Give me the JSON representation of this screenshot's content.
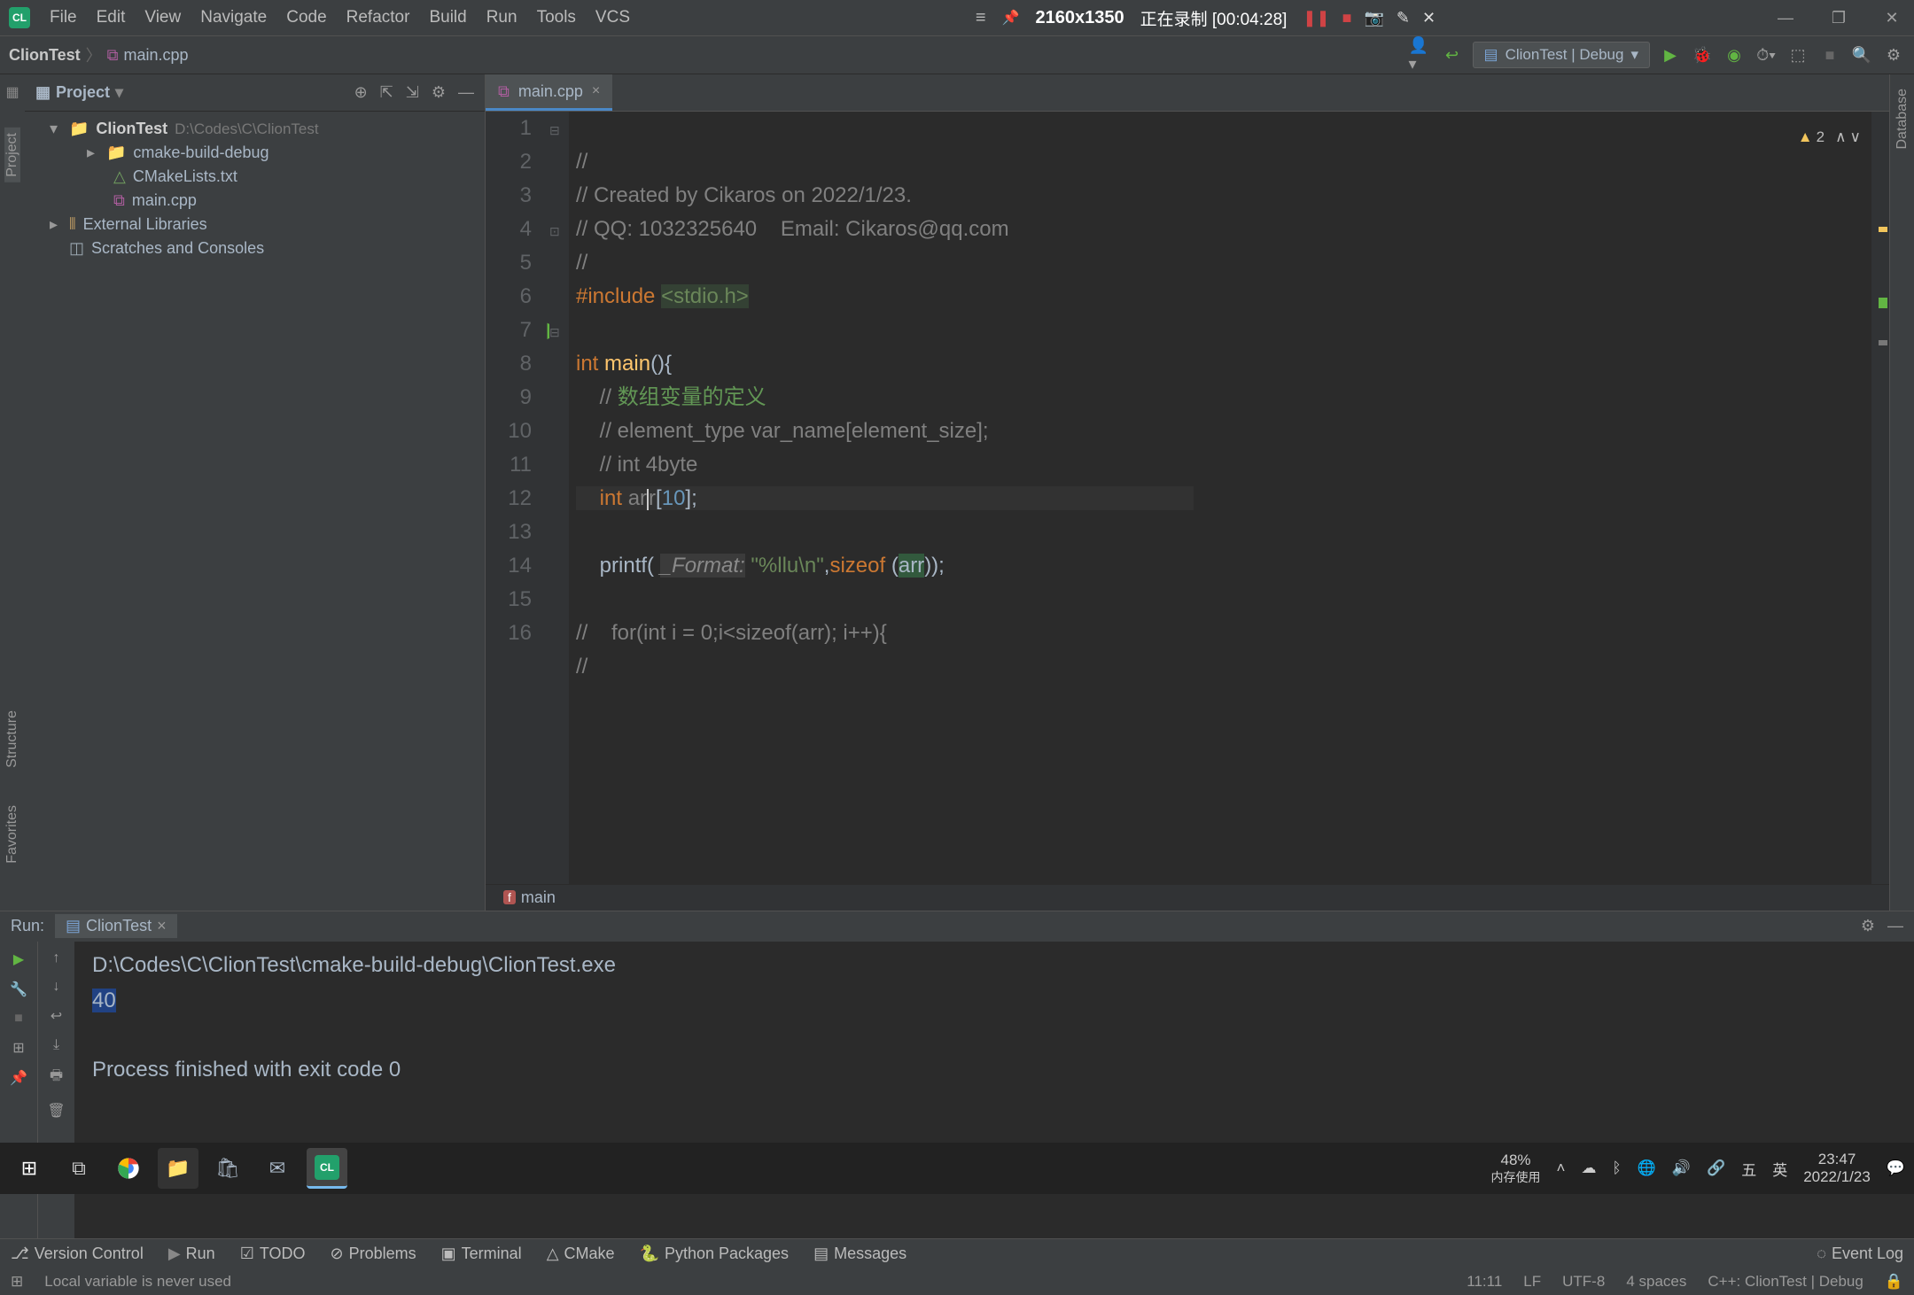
{
  "menu": [
    "File",
    "Edit",
    "View",
    "Navigate",
    "Code",
    "Refactor",
    "Build",
    "Run",
    "Tools",
    "VCS"
  ],
  "recorder": {
    "resolution": "2160x1350",
    "status": "正在录制 [00:04:28]"
  },
  "breadcrumb": {
    "project": "ClionTest",
    "file": "main.cpp"
  },
  "run_config": {
    "label": "ClionTest | Debug"
  },
  "project_panel": {
    "title": "Project",
    "root": "ClionTest",
    "root_path": "D:\\Codes\\C\\ClionTest",
    "items": [
      {
        "label": "cmake-build-debug",
        "type": "folder-debug",
        "indent": 2,
        "expandable": true
      },
      {
        "label": "CMakeLists.txt",
        "type": "file",
        "indent": 3
      },
      {
        "label": "main.cpp",
        "type": "file",
        "indent": 3
      },
      {
        "label": "External Libraries",
        "type": "lib",
        "indent": 1,
        "expandable": true
      },
      {
        "label": "Scratches and Consoles",
        "type": "scratch",
        "indent": 1
      }
    ]
  },
  "editor": {
    "tab": "main.cpp",
    "warnings": "2",
    "breadcrumb_fn": "main",
    "lines": [
      {
        "n": 1,
        "raw": "//"
      },
      {
        "n": 2,
        "raw": "// Created by Cikaros on 2022/1/23."
      },
      {
        "n": 3,
        "raw": "// QQ: 1032325640    Email: Cikaros@qq.com"
      },
      {
        "n": 4,
        "raw": "//"
      },
      {
        "n": 5,
        "raw": "#include <stdio.h>"
      },
      {
        "n": 6,
        "raw": ""
      },
      {
        "n": 7,
        "raw": "int main(){"
      },
      {
        "n": 8,
        "raw": "    // 数组变量的定义"
      },
      {
        "n": 9,
        "raw": "    // element_type var_name[element_size];"
      },
      {
        "n": 10,
        "raw": "    // int 4byte"
      },
      {
        "n": 11,
        "raw": "    int arr[10];"
      },
      {
        "n": 12,
        "raw": ""
      },
      {
        "n": 13,
        "raw": "    printf( _Format: \"%llu\\n\",sizeof (arr));"
      },
      {
        "n": 14,
        "raw": ""
      },
      {
        "n": 15,
        "raw": "//    for(int i = 0;i<sizeof(arr); i++){"
      },
      {
        "n": 16,
        "raw": "//"
      }
    ]
  },
  "run": {
    "title": "Run:",
    "tab": "ClionTest",
    "output_path": "D:\\Codes\\C\\ClionTest\\cmake-build-debug\\ClionTest.exe",
    "output_value": "40",
    "exit_line": "Process finished with exit code 0"
  },
  "tool_strip": {
    "items": [
      "Version Control",
      "Run",
      "TODO",
      "Problems",
      "Terminal",
      "CMake",
      "Python Packages",
      "Messages"
    ],
    "right": "Event Log"
  },
  "status": {
    "message": "Local variable is never used",
    "pos": "11:11",
    "eol": "LF",
    "enc": "UTF-8",
    "indent": "4 spaces",
    "context": "C++: ClionTest | Debug"
  },
  "taskbar": {
    "battery": "48%",
    "battery_label": "内存使用",
    "ime1": "五",
    "ime2": "英",
    "time": "23:47",
    "date": "2022/1/23"
  }
}
